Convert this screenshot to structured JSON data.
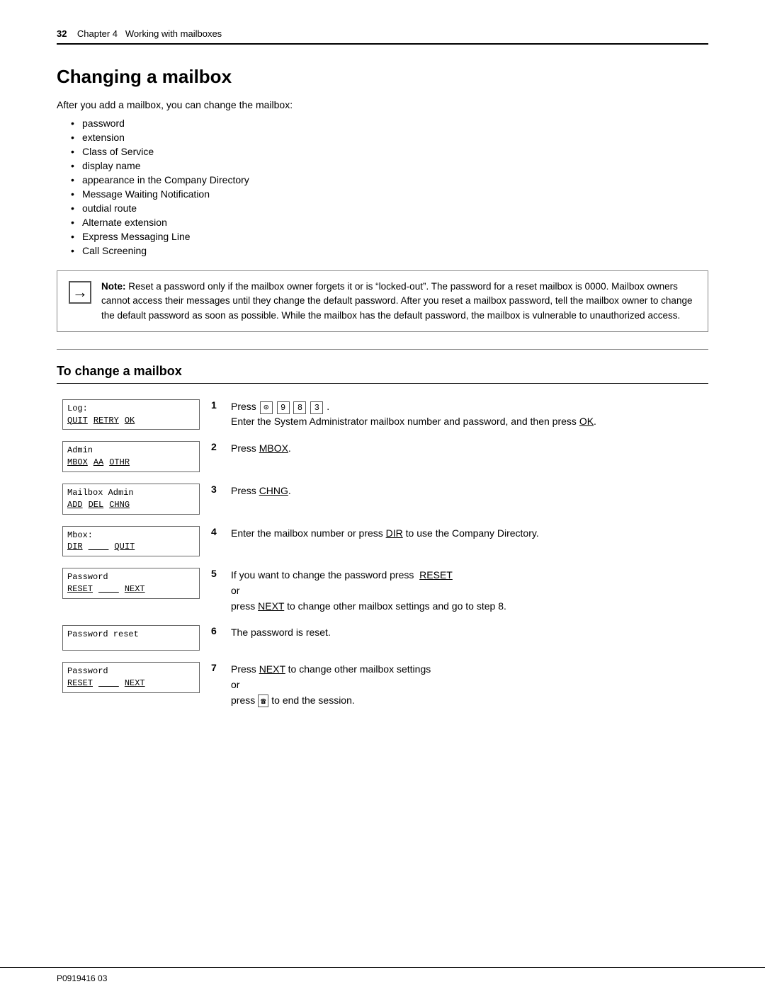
{
  "header": {
    "page_num": "32",
    "chapter": "Chapter 4",
    "chapter_title": "Working with mailboxes"
  },
  "main_title": "Changing a mailbox",
  "intro": "After you add a mailbox, you can change the mailbox:",
  "bullet_items": [
    "password",
    "extension",
    "Class of Service",
    "display name",
    "appearance in the Company Directory",
    "Message Waiting Notification",
    "outdial route",
    "Alternate extension",
    "Express Messaging Line",
    "Call Screening"
  ],
  "note": {
    "label": "Note:",
    "text": "Reset a password only if the mailbox owner forgets it or is “locked-out”. The password for a reset mailbox is 0000. Mailbox owners cannot access their messages until they change the default password. After you reset a mailbox password, tell the mailbox owner to change the default password as soon as possible. While the mailbox has the default password, the mailbox is vulnerable to unauthorized access."
  },
  "section_title": "To change a mailbox",
  "steps": [
    {
      "screen_top": "Log:",
      "screen_btns": [
        "QUIT",
        "RETRY",
        "OK"
      ],
      "num": "1",
      "desc_parts": [
        {
          "type": "text",
          "text": "Press "
        },
        {
          "type": "keys",
          "keys": [
            "⊙",
            "9",
            "8",
            "3"
          ]
        },
        {
          "type": "text",
          "text": "."
        },
        {
          "type": "newline"
        },
        {
          "type": "text",
          "text": "Enter the System Administrator mailbox number and password, and then press "
        },
        {
          "type": "underline",
          "text": "OK"
        },
        {
          "type": "text",
          "text": "."
        }
      ]
    },
    {
      "screen_top": "Admin",
      "screen_btns": [
        "MBOX",
        "AA",
        "OTHR"
      ],
      "num": "2",
      "desc_parts": [
        {
          "type": "text",
          "text": "Press "
        },
        {
          "type": "underline",
          "text": "MBOX"
        },
        {
          "type": "text",
          "text": "."
        }
      ]
    },
    {
      "screen_top": "Mailbox Admin",
      "screen_btns": [
        "ADD",
        "DEL",
        "CHNG"
      ],
      "num": "3",
      "desc_parts": [
        {
          "type": "text",
          "text": "Press "
        },
        {
          "type": "underline",
          "text": "CHNG"
        },
        {
          "type": "text",
          "text": "."
        }
      ]
    },
    {
      "screen_top": "Mbox:",
      "screen_btns": [
        "DIR",
        "",
        "QUIT"
      ],
      "num": "4",
      "desc_parts": [
        {
          "type": "text",
          "text": "Enter the mailbox number or press "
        },
        {
          "type": "underline",
          "text": "DIR"
        },
        {
          "type": "text",
          "text": " to use the Company Directory."
        }
      ]
    },
    {
      "screen_top": "Password",
      "screen_btns": [
        "RESET",
        "",
        "NEXT"
      ],
      "num": "5",
      "desc_parts": [
        {
          "type": "text",
          "text": "If you want to change the password press  "
        },
        {
          "type": "underline",
          "text": "RESET"
        },
        {
          "type": "newline"
        },
        {
          "type": "text",
          "text": "or"
        },
        {
          "type": "newline"
        },
        {
          "type": "text",
          "text": "press "
        },
        {
          "type": "underline",
          "text": "NEXT"
        },
        {
          "type": "text",
          "text": " to change other mailbox settings and go to step 8."
        }
      ]
    },
    {
      "screen_top": "Password reset",
      "screen_btns": [],
      "num": "6",
      "desc_parts": [
        {
          "type": "text",
          "text": "The password is reset."
        }
      ]
    },
    {
      "screen_top": "Password",
      "screen_btns": [
        "RESET",
        "",
        "NEXT"
      ],
      "num": "7",
      "desc_parts": [
        {
          "type": "text",
          "text": "Press "
        },
        {
          "type": "underline",
          "text": "NEXT"
        },
        {
          "type": "text",
          "text": " to change other mailbox settings"
        },
        {
          "type": "newline"
        },
        {
          "type": "text",
          "text": "or"
        },
        {
          "type": "newline"
        },
        {
          "type": "text",
          "text": "press "
        },
        {
          "type": "telephone"
        },
        {
          "type": "text",
          "text": " to end the session."
        }
      ]
    }
  ],
  "footer": {
    "part_number": "P0919416 03"
  }
}
